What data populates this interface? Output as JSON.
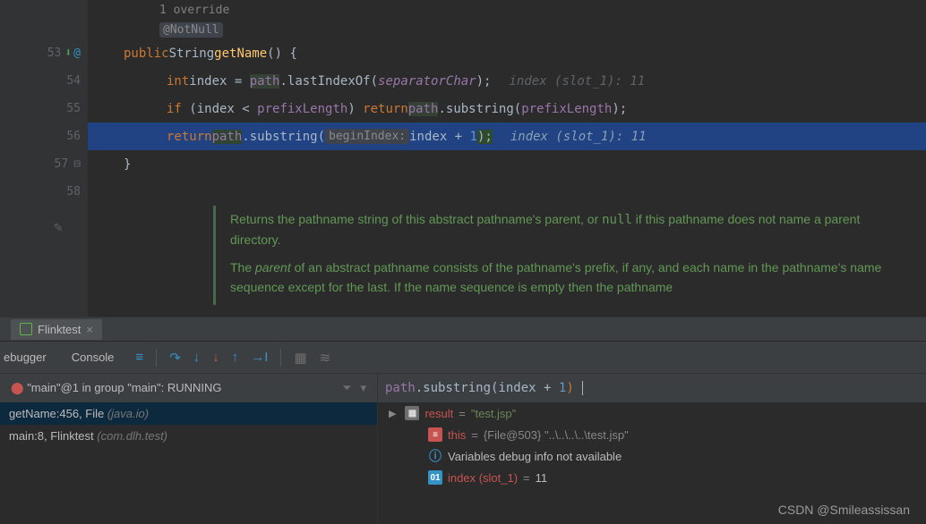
{
  "editor": {
    "override_text": "1 override",
    "annotation": "@NotNull",
    "lines": {
      "53": {
        "num": "53"
      },
      "54": {
        "num": "54"
      },
      "55": {
        "num": "55"
      },
      "56": {
        "num": "56"
      },
      "57": {
        "num": "57"
      },
      "58": {
        "num": "58"
      }
    },
    "tokens": {
      "public": "public",
      "string": "String",
      "getName": "getName",
      "lparen_rparen_brace": "() {",
      "int": "int",
      "index_var": "index",
      "eq": " = ",
      "path": "path",
      "dot_lastIndexOf": ".lastIndexOf(",
      "separatorChar": "separatorChar",
      "close_semi": ");",
      "hint1": "index (slot_1): 11",
      "if": "if",
      "cond_open": " (index < ",
      "prefixLength": "prefixLength",
      "cond_close": ") ",
      "return": "return",
      "dot_substring_open": ".substring(",
      "close_semi2": ");",
      "beginIndex_label": "beginIndex:",
      "plus1": "index + ",
      "one": "1",
      "hint2": "index (slot_1): 11",
      "rbrace": "}"
    },
    "doc": {
      "p1_a": "Returns the pathname string of this abstract pathname's parent, or ",
      "p1_null": "null",
      "p1_b": " if this pathname does not name a parent directory.",
      "p2_a": "The ",
      "p2_parent": "parent",
      "p2_b": " of an abstract pathname consists of the pathname's prefix, if any, and each name in the pathname's name sequence except for the last. If the name sequence is empty then the pathname"
    }
  },
  "tab": {
    "name": "Flinktest"
  },
  "debugger": {
    "tab_debugger": "ebugger",
    "tab_console": "Console",
    "thread_label": "\"main\"@1 in group \"main\": RUNNING",
    "frames": [
      {
        "method": "getName:456, File ",
        "pkg": "(java.io)"
      },
      {
        "method": "main:8, Flinktest ",
        "pkg": "(com.dlh.test)"
      }
    ],
    "eval_expr_html": "path.substring(index + 1)",
    "vars": {
      "result_name": "result",
      "result_val": "\"test.jsp\"",
      "this_name": "this",
      "this_val": "{File@503} \"..\\..\\..\\..\\test.jsp\"",
      "info": "Variables debug info not available",
      "index_name": "index (slot_1)",
      "index_val": "11"
    }
  },
  "watermark": "CSDN @Smileassissan"
}
